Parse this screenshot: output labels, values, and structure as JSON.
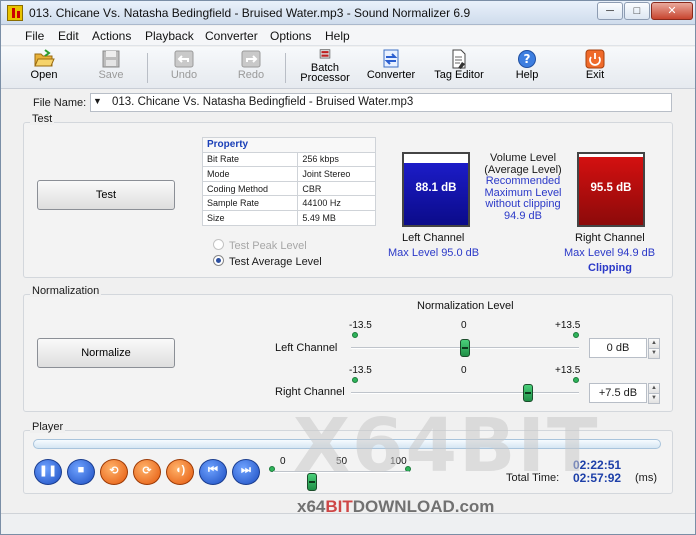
{
  "window": {
    "title": "013. Chicane Vs. Natasha Bedingfield  -  Bruised Water.mp3 - Sound Normalizer 6.9",
    "minimize": "─",
    "restore": "□",
    "close": "✕"
  },
  "menu": [
    "File",
    "Edit",
    "Actions",
    "Playback",
    "Converter",
    "Options",
    "Help"
  ],
  "toolbar": {
    "open": "Open",
    "save": "Save",
    "undo": "Undo",
    "redo": "Redo",
    "batch_1": "Batch",
    "batch_2": "Processor",
    "converter": "Converter",
    "tag_editor": "Tag Editor",
    "help": "Help",
    "exit": "Exit"
  },
  "file": {
    "label": "File Name:",
    "value": "013. Chicane Vs. Natasha Bedingfield  -  Bruised Water.mp3"
  },
  "test": {
    "group_title": "Test",
    "button": "Test",
    "properties_header": "Property",
    "properties": [
      [
        "Bit Rate",
        "256 kbps"
      ],
      [
        "Mode",
        "Joint Stereo"
      ],
      [
        "Coding Method",
        "CBR"
      ],
      [
        "Sample Rate",
        "44100 Hz"
      ],
      [
        "Size",
        "5.49 MB"
      ]
    ],
    "radio_peak": "Test Peak Level",
    "radio_average": "Test Average Level",
    "left_value": "88.1 dB",
    "left_fill": 0.88,
    "left_label": "Left Channel",
    "left_max": "Max Level 95.0 dB",
    "right_value": "95.5 dB",
    "right_fill": 0.955,
    "right_label": "Right Channel",
    "right_max": "Max Level 94.9 dB",
    "right_status": "Clipping",
    "volume_title_1": "Volume Level",
    "volume_title_2": "(Average Level)",
    "rec_1": "Recommended",
    "rec_2": "Maximum Level",
    "rec_3": "without clipping",
    "rec_4": "94.9 dB",
    "colors": {
      "left_meter": "#1c1cc8",
      "right_meter": "#d41010"
    }
  },
  "normalization": {
    "group_title": "Normalization",
    "header": "Normalization Level",
    "left_label": "Left Channel",
    "right_label": "Right Channel",
    "min": "-13.5",
    "mid": "0",
    "max": "+13.5",
    "left_value": "0 dB",
    "left_level": 0,
    "right_value": "+7.5 dB",
    "right_level": 7.5
  },
  "player": {
    "group_title": "Player",
    "vol_0": "0",
    "vol_50": "50",
    "vol_100": "100",
    "current_time": "02:22:51",
    "total_label": "Total Time:",
    "total_time": "02:57:92",
    "total_unit": "(ms)"
  },
  "watermark": {
    "logo": "X64BIT",
    "url_prefix": "x64",
    "url_bit": "BIT",
    "url_suffix": "DOWNLOAD.com"
  }
}
